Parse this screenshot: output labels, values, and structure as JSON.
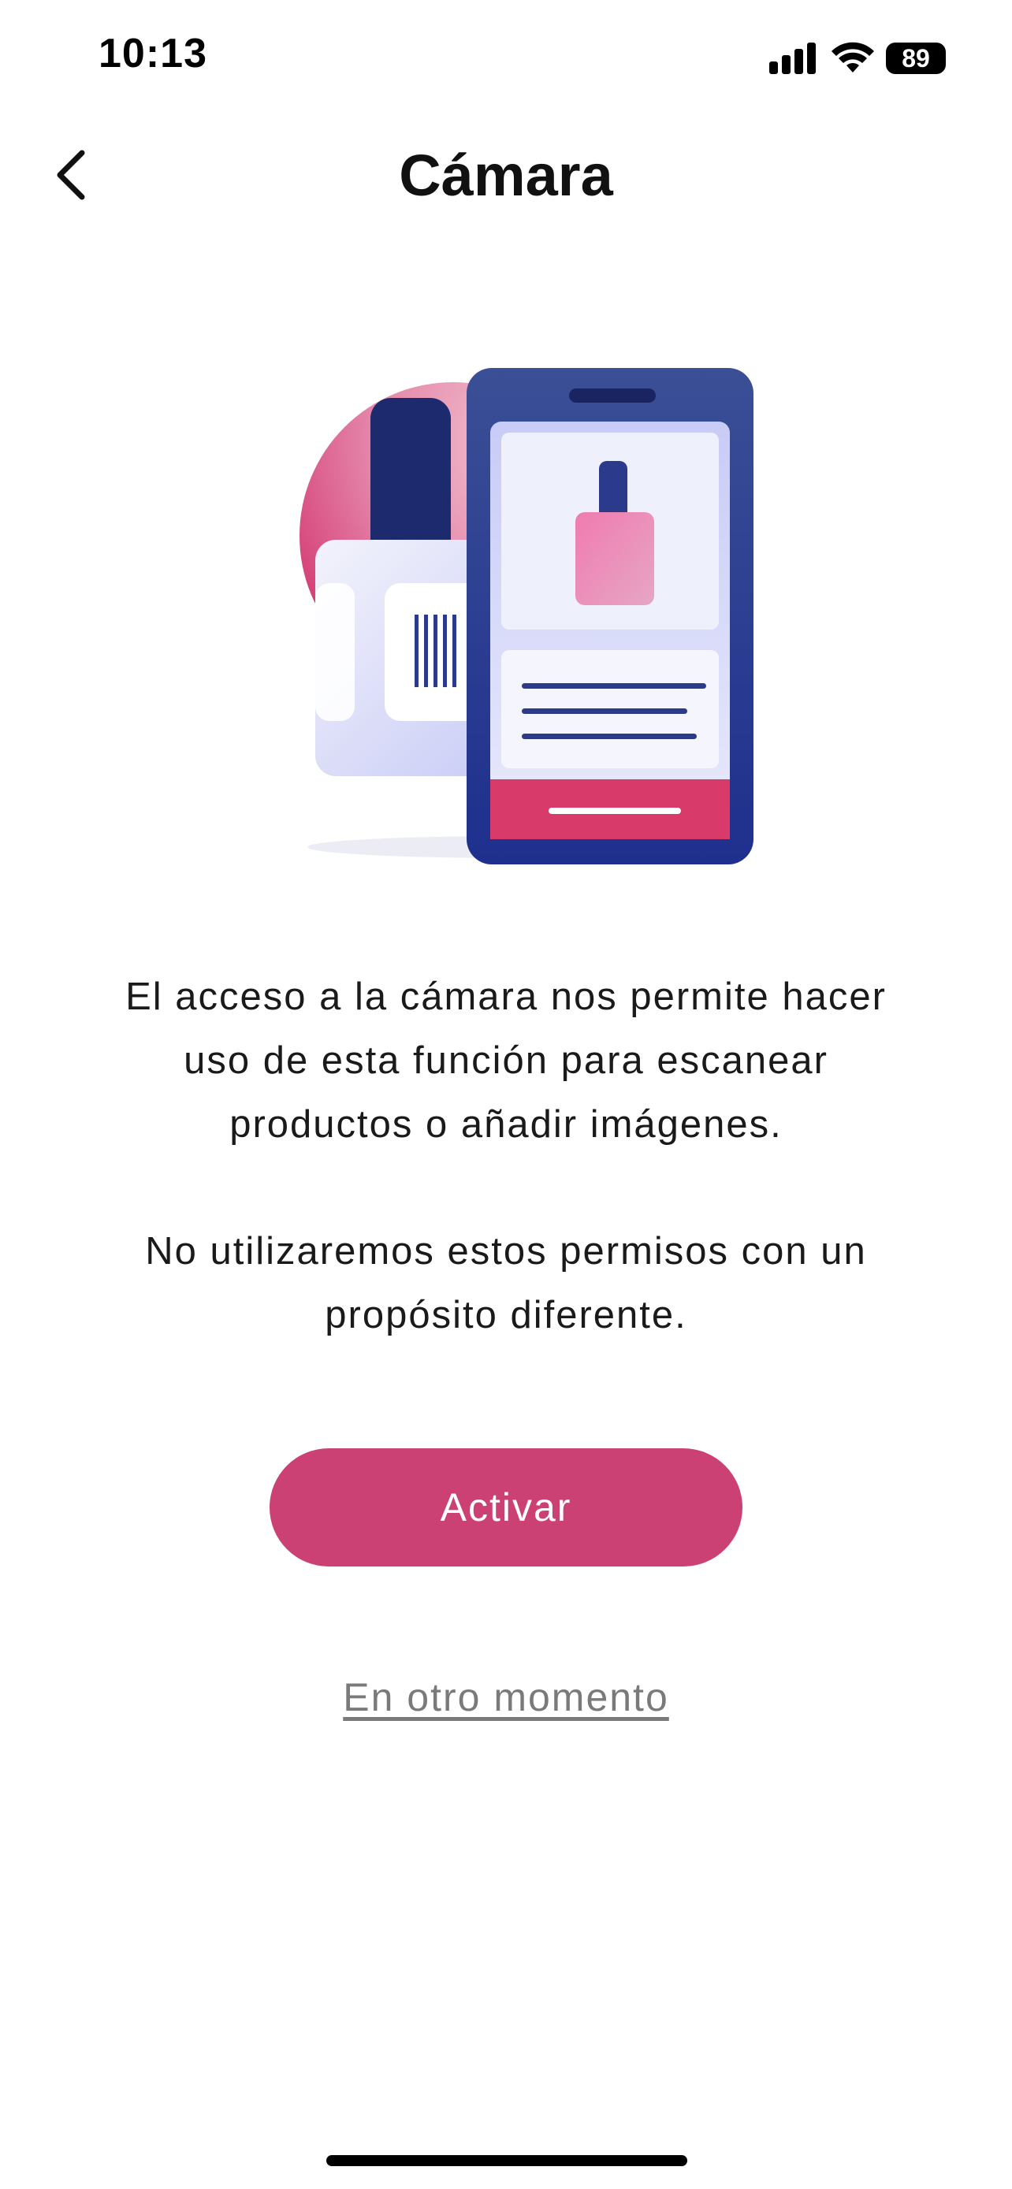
{
  "status_bar": {
    "time": "10:13",
    "battery_level": "89"
  },
  "nav": {
    "title": "Cámara",
    "back_icon": "chevron-left-icon"
  },
  "illustration": {
    "description_icons": [
      "phone-icon",
      "nail-polish-icon",
      "barcode-label-icon"
    ],
    "colors": {
      "circle": "#e27fa4",
      "phone_frame": "#2b3a8a",
      "accent_bar": "#d83a6a",
      "bottle_pink": "#e884b3",
      "card": "#dfe1fb"
    }
  },
  "content": {
    "paragraph1_line1": "El acceso a la cámara nos permite hacer",
    "paragraph1_line2": "uso de esta función para escanear",
    "paragraph1_line3": "productos o añadir imágenes.",
    "paragraph2_line1": "No utilizaremos estos permisos con un",
    "paragraph2_line2": "propósito diferente."
  },
  "actions": {
    "primary_label": "Activar",
    "secondary_label": "En otro momento",
    "primary_color": "#cc4174"
  }
}
